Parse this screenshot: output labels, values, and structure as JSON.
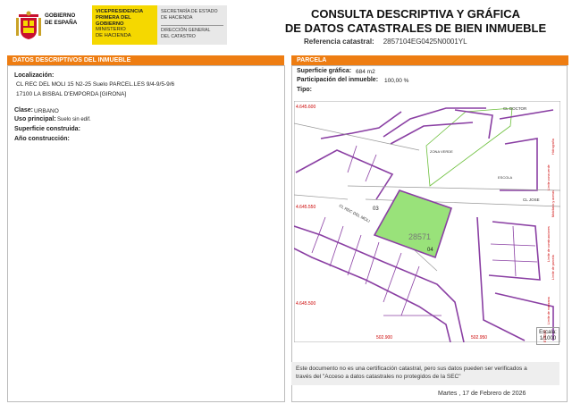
{
  "header": {
    "gov_name": [
      "GOBIERNO",
      "DE ESPAÑA"
    ],
    "yellow_lines": [
      "VICEPRESIDENCIA",
      "PRIMERA DEL GOBIERNO",
      "MINISTERIO",
      "DE HACIENDA"
    ],
    "grey_top": [
      "SECRETARÍA DE ESTADO",
      "DE HACIENDA"
    ],
    "grey_bottom": [
      "DIRECCIÓN GENERAL",
      "DEL CATASTRO"
    ],
    "title_line1": "CONSULTA DESCRIPTIVA Y GRÁFICA",
    "title_line2": "DE DATOS CATASTRALES DE BIEN INMUEBLE",
    "ref_label": "Referencia catastral:",
    "ref_value": "2857104EG0425N0001YL"
  },
  "left": {
    "section_title": "DATOS DESCRIPTIVOS DEL INMUEBLE",
    "localizacion_label": "Localización:",
    "loc_line1": "CL REC DEL MOLI 15 N2-25 Suelo PARCEL.LES 9/4-9/5-9/6",
    "loc_line2": "17100 LA BISBAL D'EMPORDA [GIRONA]",
    "clase_label": "Clase:",
    "clase_value": "URBANO",
    "uso_label": "Uso principal:",
    "uso_value": "Suelo sin edif.",
    "superficie_label": "Superficie construida:",
    "anio_label": "Año construcción:"
  },
  "right": {
    "section_title": "PARCELA",
    "sup_label": "Superficie gráfica:",
    "sup_value": "684 m2",
    "part_label": "Participación del inmueble:",
    "part_value": "100,00 %",
    "tipo_label": "Tipo:"
  },
  "map": {
    "coords": [
      "4.645.600",
      "4.645.550",
      "4.645.500",
      "502.900",
      "502.950"
    ],
    "parcel_label": "28571",
    "street_labels": [
      "CL REC DEL MOLI",
      "CL DOCTOR",
      "CL JOSE",
      "ZONA VERDE",
      "ESCOLA"
    ],
    "parcel_numbers": [
      "03",
      "04"
    ],
    "side_text_1": "Límite de manzana",
    "side_text_2": "Límite de parcela",
    "side_text_3": "Límite de construcciones",
    "side_text_4": "Mobiliario y aceras",
    "side_text_5": "Límite zona verde",
    "side_text_6": "Hidrografía",
    "side_text_7": "ETRS89",
    "scale_label": "Escala:",
    "scale_value": "1/1000",
    "parcel_fill": "#99e27a",
    "line_color": "#8a3fa3"
  },
  "footer": {
    "notice_line1": "Este documento no es una certificación catastral, pero sus datos pueden ser verificados a",
    "notice_line2": "través del \"Acceso a datos catastrales no protegidos de la SEC\"",
    "date": "Martes , 17 de Febrero de 2026"
  },
  "colors": {
    "orange": "#ee7d12",
    "yellow": "#f5d800"
  }
}
